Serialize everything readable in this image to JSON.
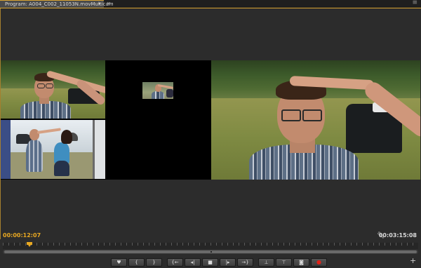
{
  "tab": {
    "title": "Program: A004_C002_11053N.movMulticam",
    "menu_glyph": "▾",
    "close_glyph": "×"
  },
  "panel": {
    "menu_glyph": "≡"
  },
  "timecode": {
    "current": "00:00:12:07",
    "duration": "00:03:15:08"
  },
  "icons": {
    "settings": "wrench-icon",
    "add": "plus-icon"
  },
  "transport": {
    "group1": [
      {
        "name": "add-marker",
        "glyph": "♥"
      },
      {
        "name": "mark-in",
        "glyph": "{"
      },
      {
        "name": "mark-out",
        "glyph": "}"
      }
    ],
    "group2": [
      {
        "name": "go-to-in",
        "glyph": "{←"
      },
      {
        "name": "step-back",
        "glyph": "◂|"
      },
      {
        "name": "stop",
        "glyph": "■"
      },
      {
        "name": "step-forward",
        "glyph": "|▸"
      },
      {
        "name": "go-to-out",
        "glyph": "→}"
      }
    ],
    "group3": [
      {
        "name": "lift",
        "glyph": "⊥"
      },
      {
        "name": "extract",
        "glyph": "⊤"
      },
      {
        "name": "export-frame",
        "glyph": "◙"
      },
      {
        "name": "record",
        "glyph": "●"
      }
    ]
  },
  "add_glyph": "+",
  "colors": {
    "accent": "#e8a822",
    "selected_camera": "#d4231b",
    "record": "#e02218"
  }
}
